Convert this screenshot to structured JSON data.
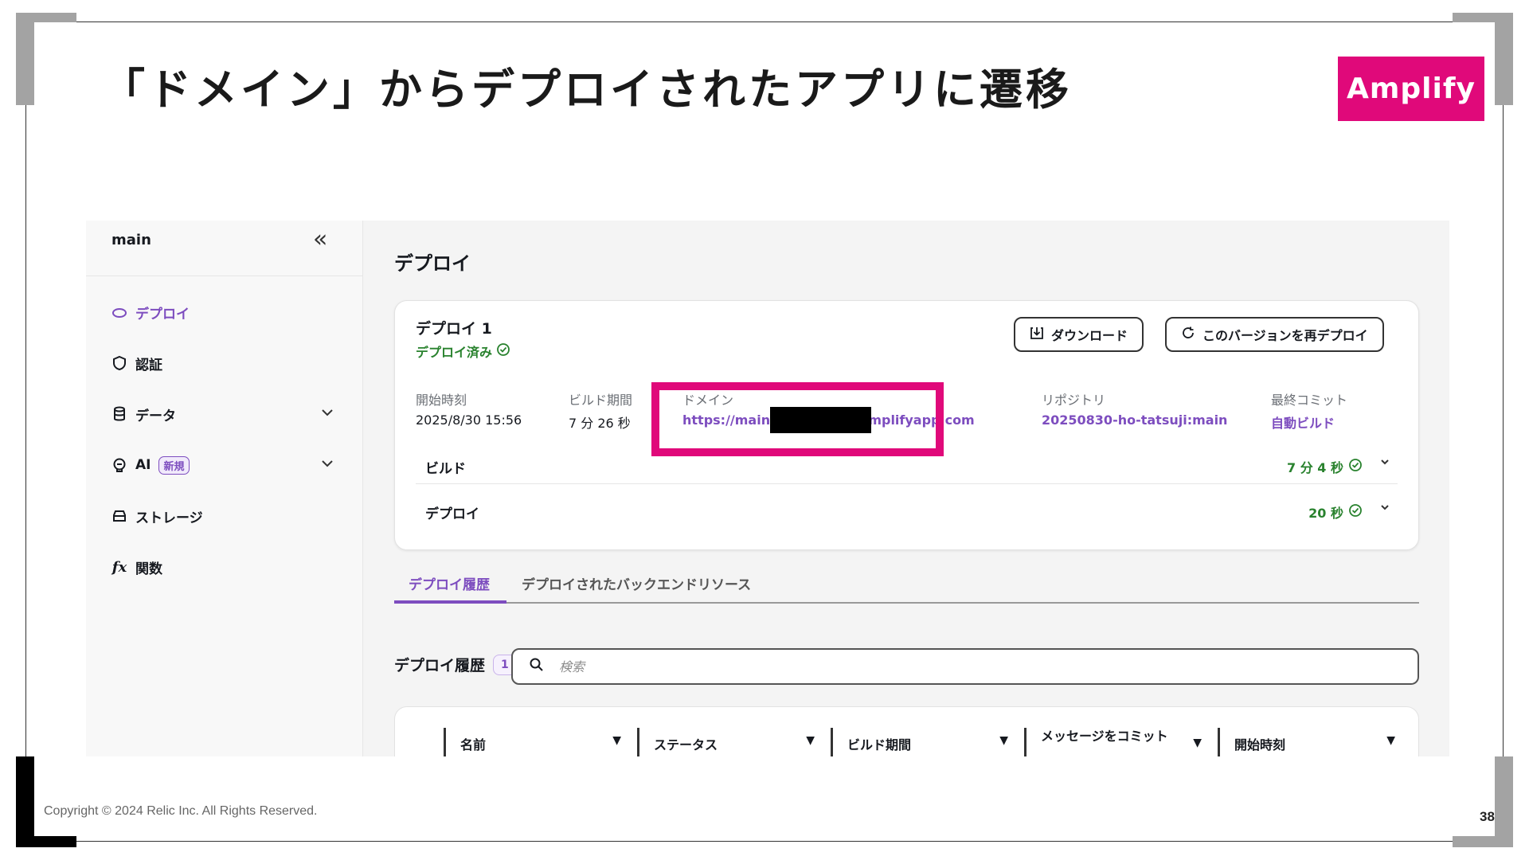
{
  "slide": {
    "title": "「ドメイン」からデプロイされたアプリに遷移",
    "brand": "Amplify",
    "copyright": "Copyright © 2024 Relic Inc. All Rights Reserved.",
    "page_number": "38",
    "accent_color": "#e0097a"
  },
  "sidebar": {
    "branch": "main",
    "items": [
      {
        "label": "デプロイ",
        "icon": "cloud-icon",
        "active": true
      },
      {
        "label": "認証",
        "icon": "shield-icon"
      },
      {
        "label": "データ",
        "icon": "database-icon"
      },
      {
        "label": "AI",
        "icon": "brain-icon",
        "badge": "新規"
      },
      {
        "label": "ストレージ",
        "icon": "storage-icon"
      },
      {
        "label": "関数",
        "icon": "function-icon"
      }
    ]
  },
  "main": {
    "page_title": "デプロイ",
    "deploy_card": {
      "title": "デプロイ 1",
      "status": "デプロイ済み",
      "download_button": "ダウンロード",
      "redeploy_button": "このバージョンを再デプロイ",
      "meta": {
        "start_label": "開始時刻",
        "start_value": "2025/8/30 15:56",
        "build_label": "ビルド期間",
        "build_value": "7 分 26 秒",
        "domain_label": "ドメイン",
        "domain_value": "https://main.                  .amplifyapp.com",
        "repo_label": "リポジトリ",
        "repo_value": "20250830-ho-tatsuji:main",
        "commit_label": "最終コミット",
        "commit_value": "自動ビルド"
      },
      "rows": [
        {
          "label": "ビルド",
          "duration": "7 分 4 秒"
        },
        {
          "label": "デプロイ",
          "duration": "20 秒"
        }
      ]
    },
    "tabs": [
      {
        "label": "デプロイ履歴",
        "active": true
      },
      {
        "label": "デプロイされたバックエンドリソース"
      }
    ],
    "history": {
      "title": "デプロイ履歴",
      "count": "1",
      "search_placeholder": "検索",
      "columns": [
        "名前",
        "ステータス",
        "ビルド期間",
        "メッセージをコミット",
        "開始時刻"
      ]
    }
  }
}
